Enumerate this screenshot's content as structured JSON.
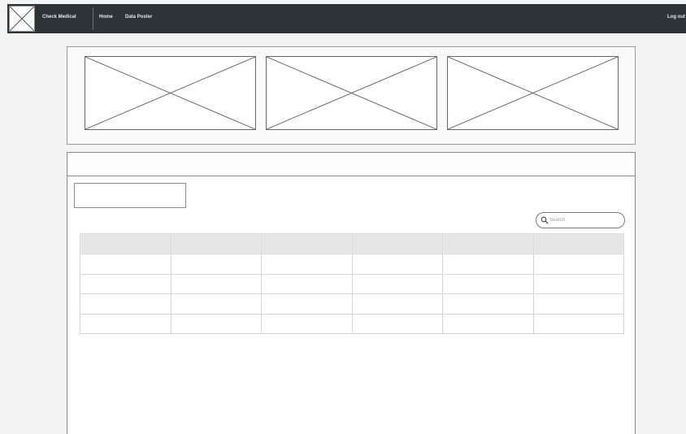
{
  "navbar": {
    "brand": "Check Medical",
    "links": [
      {
        "label": "Home"
      },
      {
        "label": "Data Poster"
      }
    ],
    "logout_label": "Log out"
  },
  "carousel": {
    "slides": [
      {
        "content": "image-placeholder"
      },
      {
        "content": "image-placeholder"
      },
      {
        "content": "image-placeholder"
      }
    ]
  },
  "search": {
    "placeholder": "Search",
    "value": ""
  },
  "table": {
    "headers": [
      "",
      "",
      "",
      "",
      "",
      ""
    ],
    "rows": [
      [
        "",
        "",
        "",
        "",
        "",
        ""
      ],
      [
        "",
        "",
        "",
        "",
        "",
        ""
      ],
      [
        "",
        "",
        "",
        "",
        "",
        ""
      ],
      [
        "",
        "",
        "",
        "",
        "",
        ""
      ]
    ]
  },
  "icons": {
    "logo": "image-placeholder-icon",
    "search": "search-icon"
  },
  "colors": {
    "navbar_background": "#2e3338",
    "nav_text": "#e6e6e6",
    "table_header_background": "#e6e6e6",
    "border": "#8a8a8a"
  }
}
